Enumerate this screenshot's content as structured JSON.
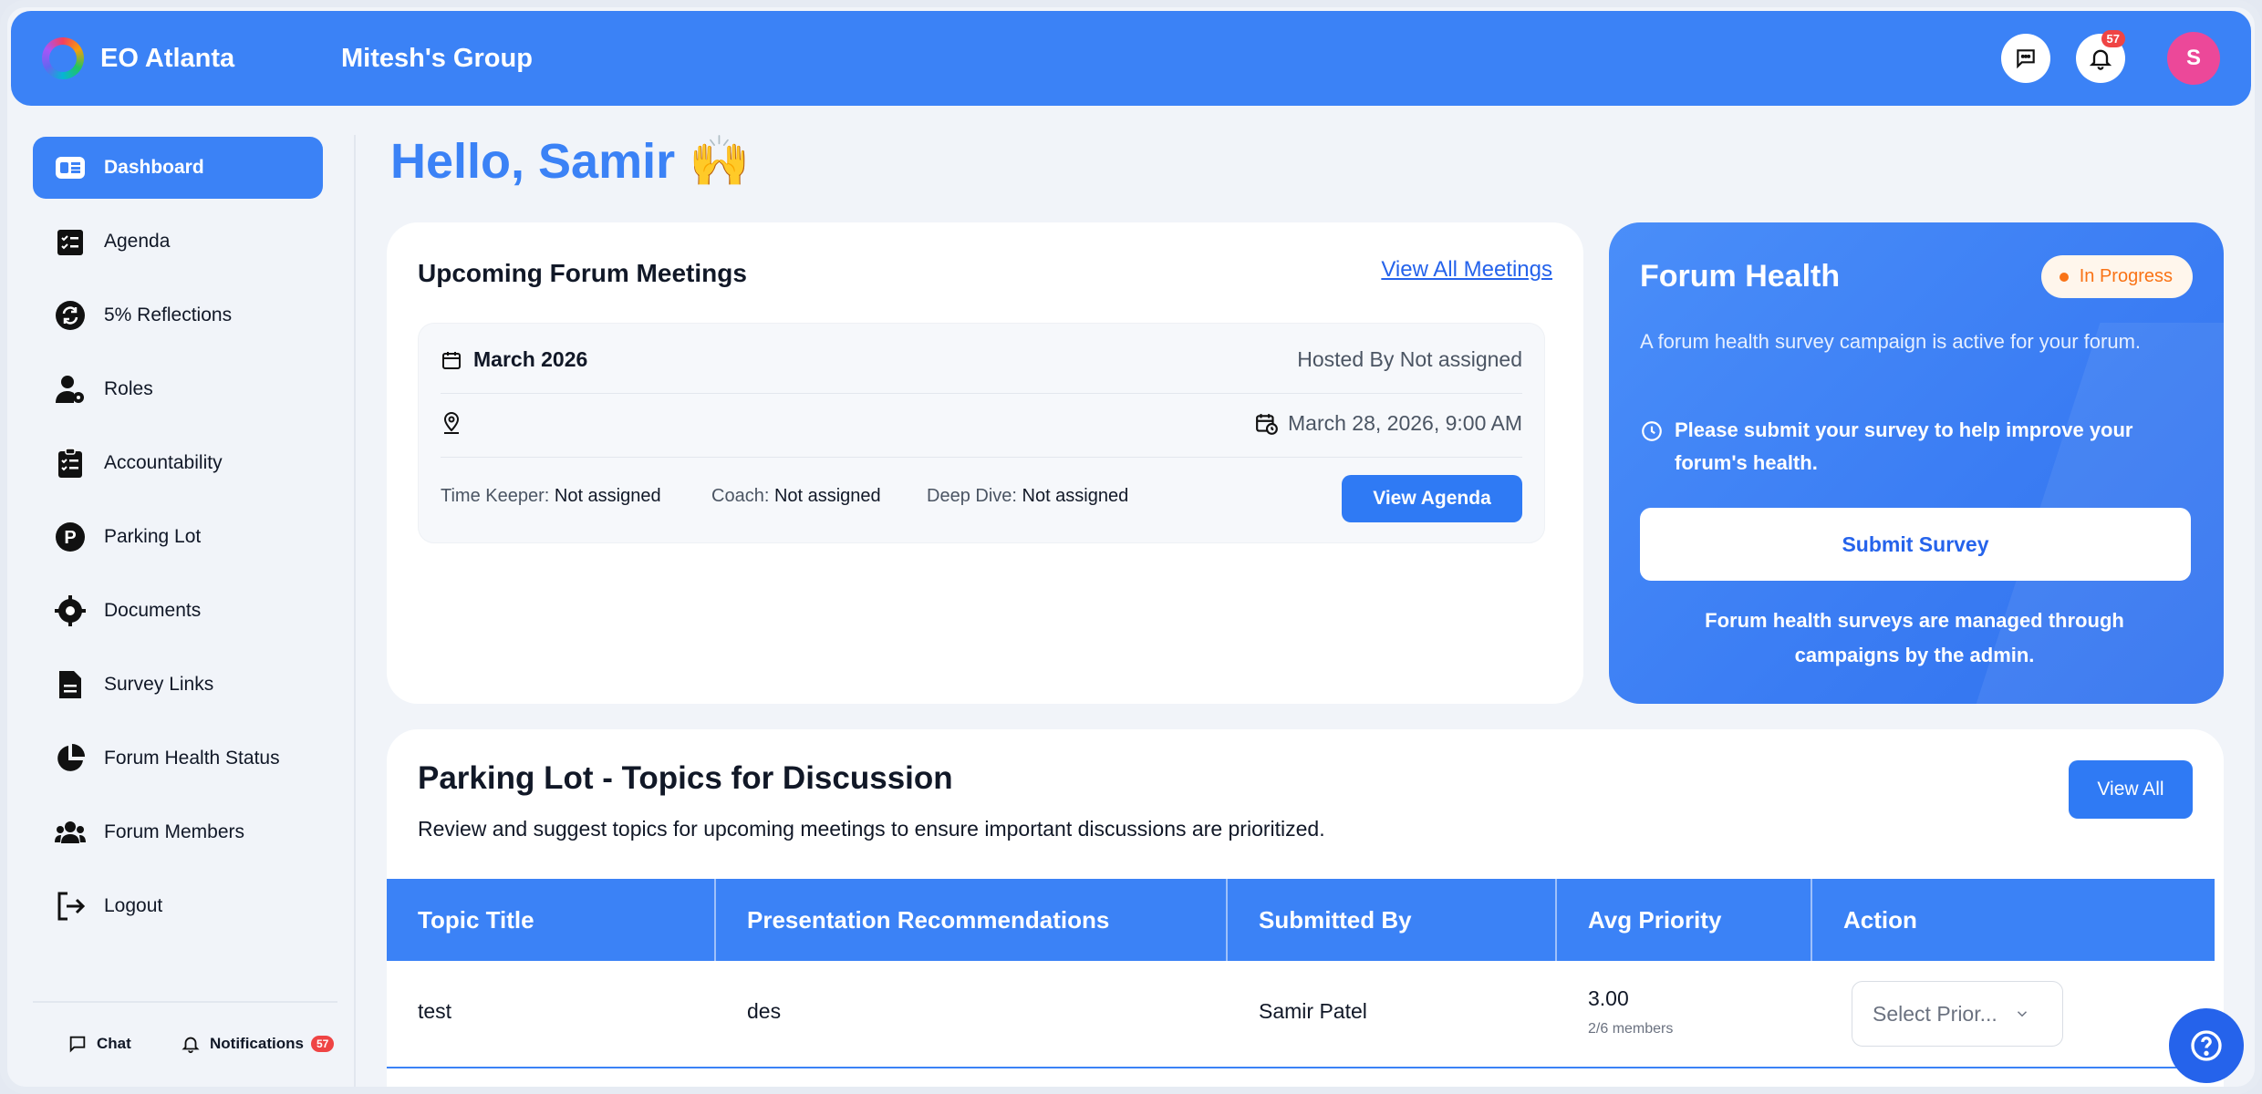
{
  "header": {
    "brand": "EO Atlanta",
    "group": "Mitesh's Group",
    "notification_count": "57",
    "avatar_initial": "S"
  },
  "sidebar": {
    "items": [
      {
        "label": "Dashboard",
        "icon": "dashboard-icon",
        "active": true
      },
      {
        "label": "Agenda",
        "icon": "agenda-icon"
      },
      {
        "label": "5% Reflections",
        "icon": "refresh-icon"
      },
      {
        "label": "Roles",
        "icon": "roles-icon"
      },
      {
        "label": "Accountability",
        "icon": "clipboard-icon"
      },
      {
        "label": "Parking Lot",
        "icon": "parking-icon"
      },
      {
        "label": "Documents",
        "icon": "documents-icon"
      },
      {
        "label": "Survey Links",
        "icon": "file-icon"
      },
      {
        "label": "Forum Health Status",
        "icon": "pie-icon"
      },
      {
        "label": "Forum Members",
        "icon": "members-icon"
      },
      {
        "label": "Logout",
        "icon": "logout-icon"
      }
    ],
    "footer": {
      "chat_label": "Chat",
      "notifications_label": "Notifications",
      "notifications_count": "57"
    }
  },
  "greeting": {
    "text": "Hello, Samir",
    "emoji": "🙌"
  },
  "meetings": {
    "title": "Upcoming Forum Meetings",
    "view_all_label": "View All Meetings",
    "month": "March 2026",
    "hosted_by": "Hosted By Not assigned",
    "datetime": "March 28, 2026, 9:00 AM",
    "time_keeper_label": "Time Keeper:",
    "time_keeper_value": "Not assigned",
    "coach_label": "Coach:",
    "coach_value": "Not assigned",
    "deep_dive_label": "Deep Dive:",
    "deep_dive_value": "Not assigned",
    "view_agenda_label": "View Agenda"
  },
  "forum_health": {
    "title": "Forum Health",
    "status": "In Progress",
    "description": "A forum health survey campaign is active for your forum.",
    "notice": "Please submit your survey to help improve your forum's health.",
    "submit_label": "Submit Survey",
    "footnote": "Forum health surveys are managed through campaigns by the admin.",
    "status_color": "#f97316"
  },
  "parking_lot": {
    "title": "Parking Lot - Topics for Discussion",
    "subtitle": "Review and suggest topics for upcoming meetings to ensure important discussions are prioritized.",
    "view_all_label": "View All",
    "columns": [
      "Topic Title",
      "Presentation Recommendations",
      "Submitted By",
      "Avg Priority",
      "Action"
    ],
    "rows": [
      {
        "topic": "test",
        "recommendation": "des",
        "submitted_by": "Samir Patel",
        "avg_priority": "3.00",
        "members": "2/6 members",
        "action_placeholder": "Select Prior..."
      }
    ]
  },
  "colors": {
    "accent": "#3b82f6",
    "badge": "#ef4444",
    "avatar": "#ec4899"
  }
}
